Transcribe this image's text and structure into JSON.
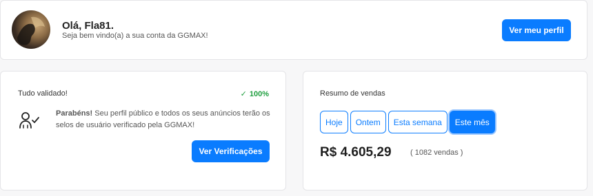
{
  "welcome": {
    "greeting": "Olá, Fla81.",
    "subtitle": "Seja bem vindo(a) a sua conta da GGMAX!",
    "profile_button": "Ver meu perfil"
  },
  "verification": {
    "title": "Tudo validado!",
    "progress": "100%",
    "check_glyph": "✓",
    "message_bold": "Parabéns!",
    "message_rest": " Seu perfil público e todos os seus anúncios terão os selos de usuário verificado pela GGMAX!",
    "button": "Ver Verificações",
    "icon": "user-check-icon"
  },
  "sales": {
    "title": "Resumo de vendas",
    "tabs": [
      "Hoje",
      "Ontem",
      "Esta semana",
      "Este mês"
    ],
    "active_tab": "Este mês",
    "amount": "R$ 4.605,29",
    "count": "( 1082 vendas )"
  },
  "colors": {
    "accent": "#0a7cff",
    "success": "#1e9e3e"
  }
}
